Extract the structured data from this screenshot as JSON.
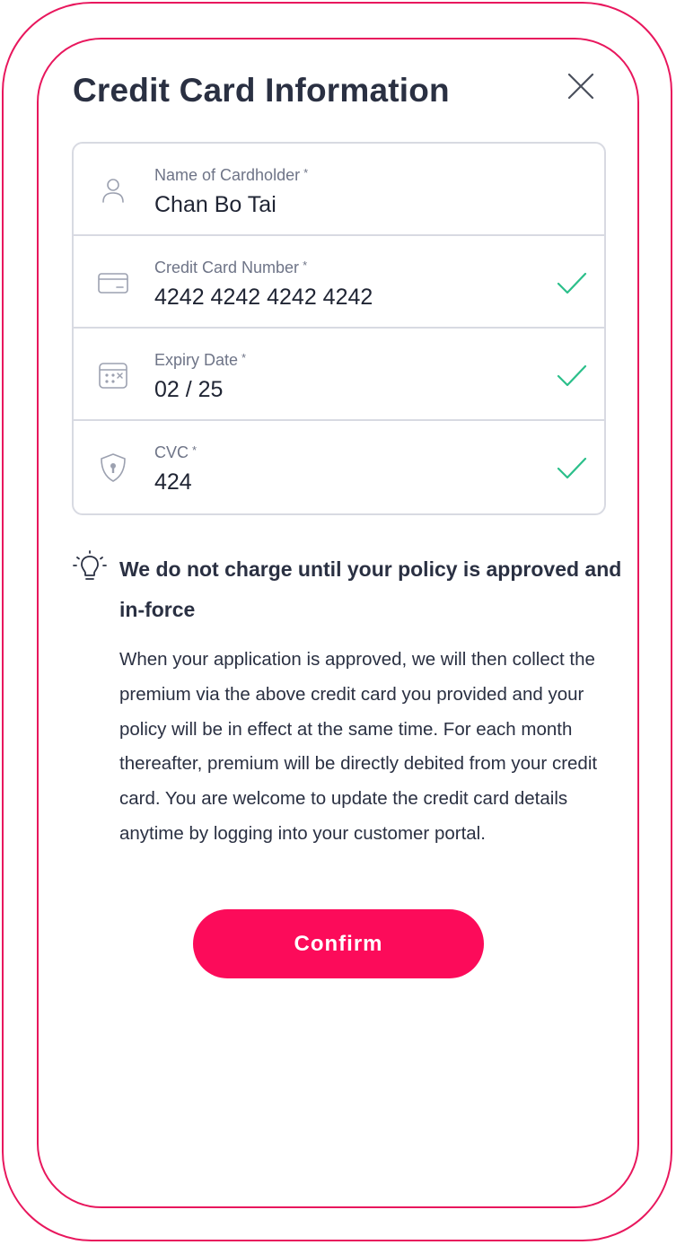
{
  "dialog": {
    "title": "Credit Card Information"
  },
  "form": {
    "required_marker": "*",
    "fields": [
      {
        "label": "Name of Cardholder",
        "value": "Chan Bo Tai",
        "icon": "user-icon",
        "valid": false
      },
      {
        "label": "Credit Card Number",
        "value": "4242 4242 4242 4242",
        "icon": "credit-card-icon",
        "valid": true
      },
      {
        "label": "Expiry Date",
        "value": "02 / 25",
        "icon": "calendar-icon",
        "valid": true
      },
      {
        "label": "CVC",
        "value": "424",
        "icon": "shield-lock-icon",
        "valid": true
      }
    ]
  },
  "notice": {
    "icon": "lightbulb-icon",
    "heading": "We do not charge until your policy is approved and in-force",
    "body": "When your application is approved, we will then collect the premium via the above credit card you provided and your policy will be in effect at the same time. For each month thereafter, premium will be directly debited from your credit card. You are welcome to update the credit card details anytime by logging into your customer portal."
  },
  "actions": {
    "confirm_label": "Confirm"
  },
  "colors": {
    "accent": "#fc0b5a",
    "frame": "#e8175d",
    "valid_check": "#2bbf8a",
    "text": "#2a3042",
    "label": "#6e7487",
    "border": "#d8dae2"
  }
}
